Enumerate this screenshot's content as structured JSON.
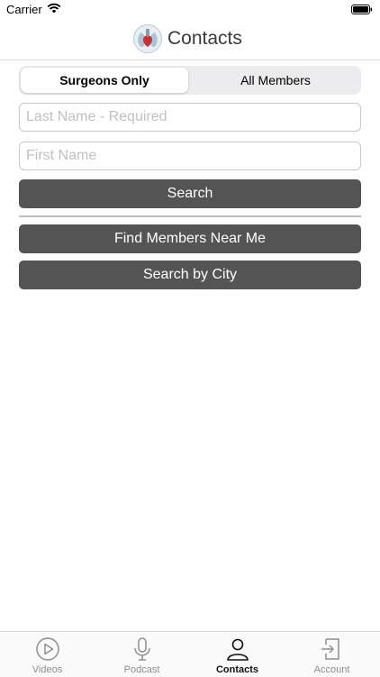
{
  "status_bar": {
    "carrier": "Carrier"
  },
  "nav": {
    "title": "Contacts"
  },
  "segmented": {
    "options": [
      "Surgeons Only",
      "All Members"
    ],
    "selected": "Surgeons Only"
  },
  "form": {
    "last_name_placeholder": "Last Name - Required",
    "first_name_placeholder": "First Name",
    "search_label": "Search"
  },
  "actions": {
    "near_label": "Find Members Near Me",
    "city_label": "Search by City"
  },
  "tabbar": {
    "items": [
      {
        "label": "Videos",
        "icon": "play-circle-icon"
      },
      {
        "label": "Podcast",
        "icon": "microphone-icon"
      },
      {
        "label": "Contacts",
        "icon": "person-icon",
        "active": true
      },
      {
        "label": "Account",
        "icon": "login-icon"
      }
    ]
  },
  "colors": {
    "button_bg": "#545454",
    "segment_bg": "#ececee",
    "active_tab": "#111111",
    "inactive_tab": "#8e8e93"
  }
}
